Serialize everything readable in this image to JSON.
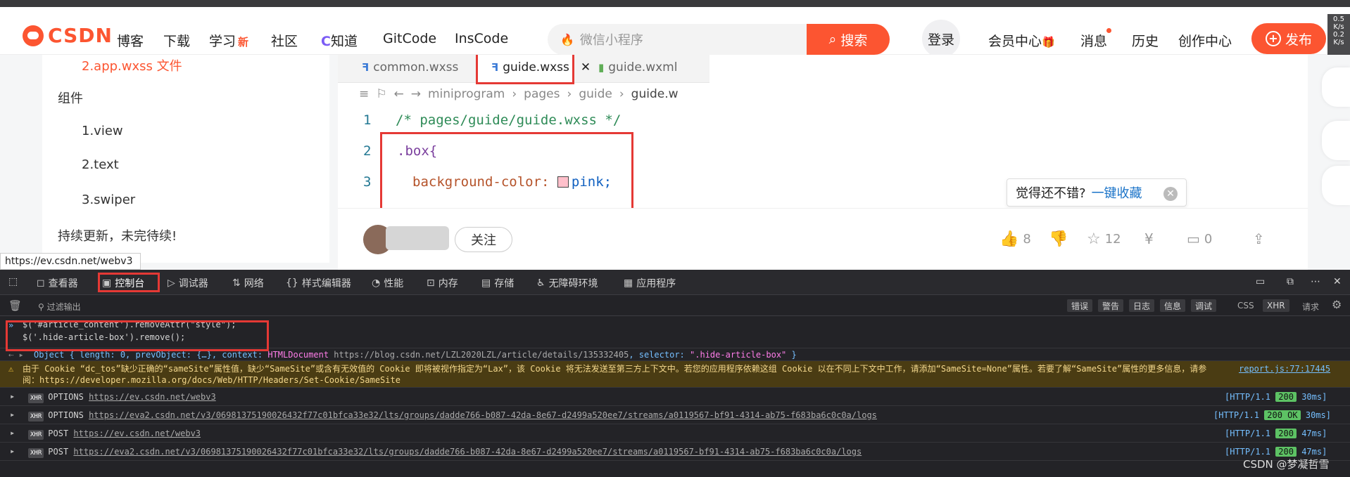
{
  "site": {
    "logo_text": "CSDN",
    "nav_links": [
      "博客",
      "下载",
      "学习",
      "社区",
      "知道",
      "GitCode",
      "InsCode"
    ],
    "new_badge": "新",
    "search_placeholder": "微信小程序",
    "search_button": "搜索",
    "login": "登录",
    "right_links": [
      "会员中心",
      "消息",
      "历史",
      "创作中心"
    ],
    "publish": "发布",
    "speed": [
      "0.5",
      "K/s",
      "0.2",
      "K/s"
    ]
  },
  "toc": {
    "active_item": "2.app.wxss 文件",
    "section": "组件",
    "items": [
      "1.view",
      "2.text",
      "3.swiper"
    ],
    "footer": "持续更新，未完待续!"
  },
  "editor": {
    "tabs": [
      "common.wxss",
      "guide.wxss",
      "guide.wxml"
    ],
    "breadcrumb": [
      "miniprogram",
      "pages",
      "guide",
      "guide.w"
    ],
    "lines": [
      {
        "n": "1",
        "text": "/* pages/guide/guide.wxss */"
      },
      {
        "n": "2",
        "text": ".box{"
      },
      {
        "n": "3",
        "text": "background-color: ",
        "value": "pink;"
      }
    ]
  },
  "tip": {
    "text": "觉得还不错?",
    "link": "一键收藏"
  },
  "author": {
    "follow": "关注"
  },
  "actions": {
    "like": "8",
    "star": "12",
    "comment": "0"
  },
  "status_url": "https://ev.csdn.net/webv3",
  "devtools": {
    "tabs": [
      "查看器",
      "控制台",
      "调试器",
      "网络",
      "样式编辑器",
      "性能",
      "内存",
      "存储",
      "无障碍环境",
      "应用程序"
    ],
    "filter_placeholder": "过滤输出",
    "filters": [
      "错误",
      "警告",
      "日志",
      "信息",
      "调试"
    ],
    "filters_plain": [
      "CSS",
      "XHR",
      "请求"
    ],
    "input": [
      "$('#article_content').removeAttr(\"style\");",
      "$('.hide-article-box').remove();"
    ],
    "result_prefix": "Object { length: 0, prevObject: {…}, context: ",
    "result_ctx": "HTMLDocument",
    "result_url": "https://blog.csdn.net/LZL2020LZL/article/details/135332405",
    "result_sel_label": ", selector: ",
    "result_sel": "\".hide-article-box\"",
    "result_end": " }",
    "warning": "由于 Cookie “dc_tos”缺少正确的“sameSite”属性值，缺少“SameSite”或含有无效值的 Cookie 即将被视作指定为“Lax”，该 Cookie 将无法发送至第三方上下文中。若您的应用程序依赖这组 Cookie 以在不同上下文中工作，请添加“SameSite=None”属性。若要了解“SameSite”属性的更多信息，请参阅：https://developer.mozilla.org/docs/Web/HTTP/Headers/Set-Cookie/SameSite",
    "warning_src": "report.js:77:17445",
    "requests": [
      {
        "method": "OPTIONS",
        "url": "https://ev.csdn.net/webv3",
        "proto": "[HTTP/1.1",
        "status": "200",
        "time": "30ms]"
      },
      {
        "method": "OPTIONS",
        "url": "https://eva2.csdn.net/v3/06981375190026432f77c01bfca33e32/lts/groups/dadde766-b087-42da-8e67-d2499a520ee7/streams/a0119567-bf91-4314-ab75-f683ba6c0c0a/logs",
        "proto": "[HTTP/1.1",
        "status": "200 OK",
        "time": "30ms]"
      },
      {
        "method": "POST",
        "url": "https://ev.csdn.net/webv3",
        "proto": "[HTTP/1.1",
        "status": "200",
        "time": "47ms]"
      },
      {
        "method": "POST",
        "url": "https://eva2.csdn.net/v3/06981375190026432f77c01bfca33e32/lts/groups/dadde766-b087-42da-8e67-d2499a520ee7/streams/a0119567-bf91-4314-ab75-f683ba6c0c0a/logs",
        "proto": "[HTTP/1.1",
        "status": "200",
        "time": "47ms]"
      }
    ],
    "xhr": "XHR"
  },
  "watermark": "CSDN @梦凝哲雪"
}
